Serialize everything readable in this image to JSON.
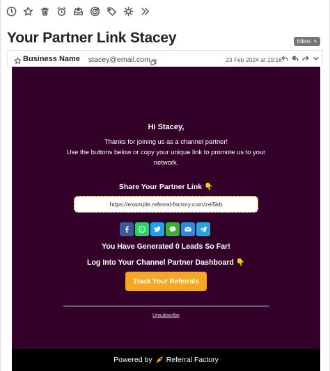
{
  "toolbar": {
    "icons": [
      "clock-icon",
      "star-icon",
      "trash-icon",
      "alarm-icon",
      "inbox-download-icon",
      "target-icon",
      "tag-icon",
      "sun-icon",
      "double-chevron-right-icon"
    ]
  },
  "subject": "Your Partner Link Stacey",
  "badge": {
    "label": "Inbox",
    "close": "×"
  },
  "header": {
    "sender_name": "Business Name",
    "sender_email": "stacey@email.com",
    "date": "23 Feb 2024 at 19:16"
  },
  "email": {
    "greeting": "Hi Stacey,",
    "intro_line1": "Thanks for joining us as a channel partner!",
    "intro_line2": "Use the buttons below or copy your unique link to promote us to your network.",
    "share_title": "Share Your Partner Link 👇",
    "link": "https://example.referral-factory.com/zel5kb",
    "share_buttons": [
      {
        "name": "facebook",
        "color": "#3b5998"
      },
      {
        "name": "whatsapp",
        "color": "#25d366"
      },
      {
        "name": "twitter",
        "color": "#1da1f2"
      },
      {
        "name": "sms",
        "color": "#3cb034"
      },
      {
        "name": "email",
        "color": "#2d8cd9"
      },
      {
        "name": "telegram",
        "color": "#2aa3e0"
      }
    ],
    "leads_text": "You Have Generated 0 Leads So Far!",
    "dashboard_text": "Log Into Your Channel Partner Dashboard 👇",
    "cta_label": "Track Your Referrals",
    "unsubscribe": "Unsubscribe",
    "footer_prefix": "Powered by",
    "footer_brand": "Referral Factory"
  },
  "colors": {
    "email_bg": "#33002a",
    "cta": "#f5a623",
    "footer_bg": "#000000",
    "link_border": "#d48a3a"
  }
}
